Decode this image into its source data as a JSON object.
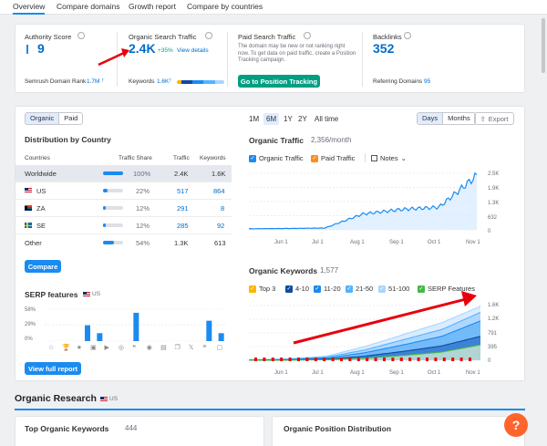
{
  "tabs": [
    "Overview",
    "Compare domains",
    "Growth report",
    "Compare by countries"
  ],
  "kpis": {
    "authority": {
      "title": "Authority Score",
      "value": "9",
      "footer_label": "Semrush Domain Rank",
      "footer_value": "1.7M"
    },
    "organic": {
      "title": "Organic Search Traffic",
      "value": "2.4K",
      "change": "+35%",
      "link": "View details",
      "footer_label": "Keywords",
      "footer_value": "1.6K"
    },
    "paid": {
      "title": "Paid Search Traffic",
      "desc": "The domain may be new or not ranking right now. To get data on paid traffic, create a Position Tracking campaign.",
      "button": "Go to Position Tracking"
    },
    "backlinks": {
      "title": "Backlinks",
      "value": "352",
      "footer_label": "Referring Domains",
      "footer_value": "95"
    }
  },
  "toggle": {
    "organic": "Organic",
    "paid": "Paid"
  },
  "distribution": {
    "title": "Distribution by Country",
    "headers": [
      "Countries",
      "Traffic Share",
      "Traffic",
      "Keywords"
    ],
    "rows": [
      {
        "country": "Worldwide",
        "share": "100%",
        "share_value": 100,
        "traffic": "2.4K",
        "keywords": "1.6K",
        "flag": ""
      },
      {
        "country": "US",
        "share": "22%",
        "share_value": 22,
        "traffic": "517",
        "keywords": "864",
        "flag": "us"
      },
      {
        "country": "ZA",
        "share": "12%",
        "share_value": 12,
        "traffic": "291",
        "keywords": "8",
        "flag": "za"
      },
      {
        "country": "SE",
        "share": "12%",
        "share_value": 12,
        "traffic": "285",
        "keywords": "92",
        "flag": "se"
      },
      {
        "country": "Other",
        "share": "54%",
        "share_value": 54,
        "traffic": "1.3K",
        "keywords": "613",
        "flag": ""
      }
    ],
    "compare_button": "Compare"
  },
  "serp": {
    "title": "SERP features",
    "db": "US",
    "y_ticks": [
      "58%",
      "29%",
      "0%"
    ],
    "bars": [
      0,
      0,
      0,
      28,
      14,
      0,
      0,
      50,
      0,
      0,
      0,
      0,
      0,
      36,
      14
    ],
    "icons": [
      "star-icon",
      "trophy-icon",
      "star-filled-icon",
      "image-icon",
      "play-icon",
      "globe-icon",
      "quote-icon",
      "location-icon",
      "newspaper-icon",
      "copy-icon",
      "twitter-x-icon",
      "list-icon",
      "frame-icon"
    ],
    "full_report_button": "View full report"
  },
  "time_range": [
    "1M",
    "6M",
    "1Y",
    "2Y",
    "All time"
  ],
  "time_range_selected": "6M",
  "gran_toggle": {
    "days": "Days",
    "months": "Months"
  },
  "export_label": "Export",
  "organic_traffic": {
    "title": "Organic Traffic",
    "value": "2,356/month",
    "legend": [
      {
        "label": "Organic Traffic",
        "color": "#1a8bf0"
      },
      {
        "label": "Paid Traffic",
        "color": "#ff8c1a"
      }
    ],
    "notes_label": "Notes",
    "y_ticks": [
      "2.5K",
      "1.9K",
      "1.3K",
      "632",
      "0"
    ],
    "x_ticks": [
      "Jun 1",
      "Jul 1",
      "Aug 1",
      "Sep 1",
      "Oct 1",
      "Nov 1"
    ]
  },
  "organic_keywords": {
    "title": "Organic Keywords",
    "value": "1,577",
    "legend": [
      {
        "label": "Top 3",
        "color": "#ffb400"
      },
      {
        "label": "4-10",
        "color": "#0e4aa3"
      },
      {
        "label": "11-20",
        "color": "#1a8bf0"
      },
      {
        "label": "21-50",
        "color": "#52b4ff"
      },
      {
        "label": "51-100",
        "color": "#a8d6ff"
      },
      {
        "label": "SERP Features",
        "color": "#46b84a"
      }
    ],
    "y_ticks": [
      "1.6K",
      "1.2K",
      "791",
      "395",
      "0"
    ],
    "x_ticks": [
      "Jun 1",
      "Jul 1",
      "Aug 1",
      "Sep 1",
      "Oct 1",
      "Nov 1"
    ]
  },
  "organic_research": {
    "title": "Organic Research",
    "db": "US"
  },
  "top_keywords": {
    "title": "Top Organic Keywords",
    "count": "444"
  },
  "position_distribution": {
    "title": "Organic Position Distribution"
  },
  "help_label": "?",
  "colors": {
    "accent": "#1a8bf0",
    "green": "#009f81",
    "annotation_red": "#e8000b"
  },
  "chart_data": [
    {
      "type": "area",
      "title": "Organic Traffic",
      "x": [
        "Jun 1",
        "Jul 1",
        "Aug 1",
        "Sep 1",
        "Oct 1",
        "Nov 1"
      ],
      "ylim": [
        0,
        2500
      ],
      "series": [
        {
          "name": "Organic Traffic",
          "values": [
            50,
            60,
            80,
            700,
            900,
            1000,
            2400
          ]
        }
      ]
    },
    {
      "type": "area",
      "title": "Organic Keywords",
      "x": [
        "Jun 1",
        "Jul 1",
        "Aug 1",
        "Sep 1",
        "Oct 1",
        "Nov 1"
      ],
      "ylim": [
        0,
        1600
      ],
      "series": [
        {
          "name": "51-100",
          "values": [
            10,
            40,
            120,
            400,
            750,
            1100,
            1577
          ]
        },
        {
          "name": "21-50",
          "values": [
            8,
            30,
            90,
            300,
            600,
            900,
            1400
          ]
        },
        {
          "name": "11-20",
          "values": [
            6,
            20,
            60,
            220,
            450,
            700,
            1150
          ]
        },
        {
          "name": "4-10",
          "values": [
            4,
            10,
            30,
            120,
            260,
            420,
            700
          ]
        },
        {
          "name": "SERP Features",
          "values": [
            2,
            5,
            15,
            60,
            140,
            240,
            450
          ]
        }
      ]
    }
  ]
}
